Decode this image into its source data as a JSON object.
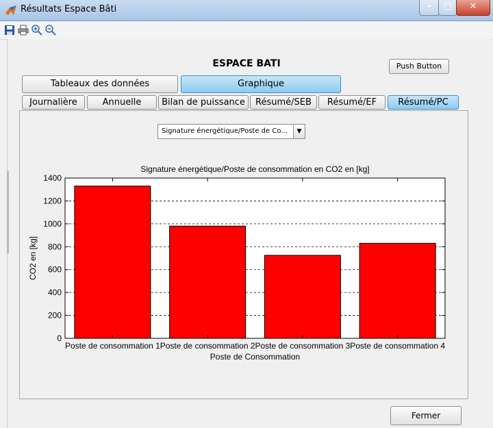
{
  "window": {
    "title": "Résultats Espace Bâti"
  },
  "toolbar": {
    "icons": [
      "save-icon",
      "print-icon",
      "zoom-in-icon",
      "zoom-out-icon"
    ]
  },
  "header": {
    "title": "ESPACE BATI"
  },
  "push_button": {
    "label": "Push Button"
  },
  "tabs": [
    {
      "label": "Tableaux des données",
      "active": false
    },
    {
      "label": "Graphique",
      "active": true
    }
  ],
  "subtabs": [
    {
      "label": "Journalière",
      "active": false
    },
    {
      "label": "Annuelle",
      "active": false
    },
    {
      "label": "Bilan de puissance",
      "active": false
    },
    {
      "label": "Résumé/SEB",
      "active": false
    },
    {
      "label": "Résumé/EF",
      "active": false
    },
    {
      "label": "Résumé/PC",
      "active": true
    }
  ],
  "dropdown": {
    "selected": "Signature énergétique/Poste de Co..."
  },
  "chart_data": {
    "type": "bar",
    "title": "Signature énergétique/Poste de consommation en CO2 en [kg]",
    "xlabel": "Poste de Consommation",
    "ylabel": "CO2 en [kg]",
    "categories": [
      "Poste de consommation 1",
      "Poste de consommation 2",
      "Poste de consommation 3",
      "Poste de consommation 4"
    ],
    "values": [
      1330,
      980,
      725,
      830
    ],
    "ylim": [
      0,
      1400
    ],
    "yticks": [
      0,
      200,
      400,
      600,
      800,
      1000,
      1200,
      1400
    ],
    "grid": "y-dashed",
    "bar_color": "#ff0000"
  },
  "footer": {
    "close_label": "Fermer"
  },
  "colors": {
    "active_tab": "#8ccbf1",
    "bar": "#ff0000"
  }
}
